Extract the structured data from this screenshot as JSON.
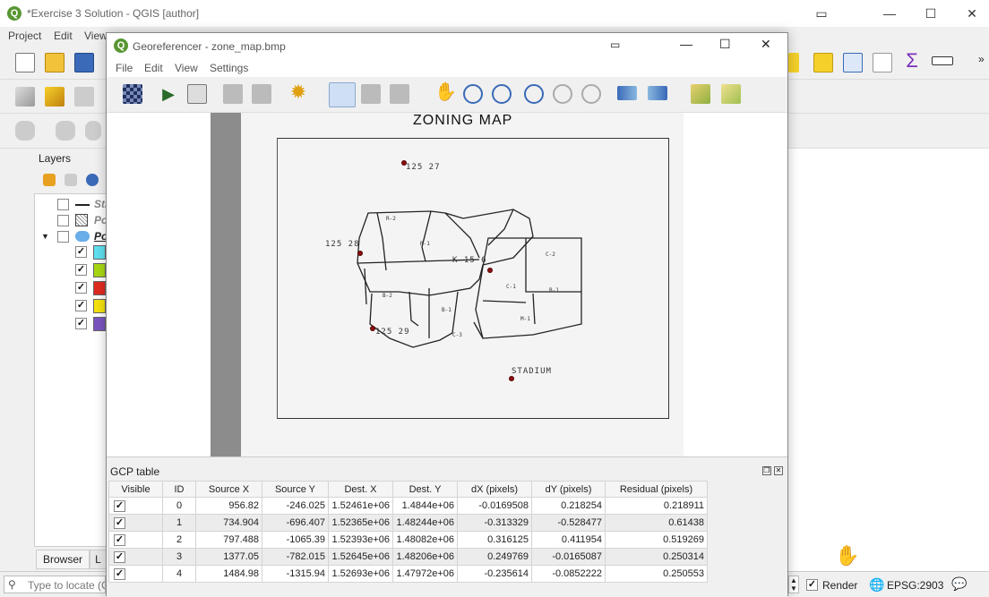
{
  "main_window": {
    "title": "*Exercise 3 Solution - QGIS [author]",
    "logo": "Q",
    "menu": [
      "Project",
      "Edit",
      "View"
    ]
  },
  "layers_panel": {
    "title": "Layers",
    "rows": [
      {
        "label": "Str",
        "checked": false
      },
      {
        "label": "Po",
        "checked": false
      },
      {
        "label": "Po",
        "checked": false
      }
    ],
    "swatches": [
      "#5fe0f0",
      "#a8d812",
      "#e02a20",
      "#f5e210",
      "#7b55c0"
    ],
    "tabs": [
      "Browser",
      "L"
    ]
  },
  "status_bar": {
    "locate_placeholder": "Type to locate (Ct",
    "render_label": "Render",
    "crs_label": "EPSG:2903"
  },
  "georeferencer": {
    "title": "Georeferencer - zone_map.bmp",
    "menu": [
      "File",
      "Edit",
      "View",
      "Settings"
    ],
    "map": {
      "heading": "ZONING MAP",
      "labels": [
        "125 27",
        "125 28",
        "K 15 6",
        "125 29",
        "STADIUM"
      ],
      "zone_labels": [
        "R-2",
        "R-1",
        "C-2",
        "B-2",
        "C-1",
        "B-1",
        "B-1",
        "M-1",
        "C-3"
      ]
    },
    "gcp_table": {
      "title": "GCP table",
      "columns": [
        "Visible",
        "ID",
        "Source X",
        "Source Y",
        "Dest. X",
        "Dest. Y",
        "dX (pixels)",
        "dY (pixels)",
        "Residual (pixels)"
      ],
      "rows": [
        {
          "visible": true,
          "id": "0",
          "source_x": "956.82",
          "source_y": "-246.025",
          "dest_x": "1.52461e+06",
          "dest_y": "1.4844e+06",
          "dx": "-0.0169508",
          "dy": "0.218254",
          "residual": "0.218911"
        },
        {
          "visible": true,
          "id": "1",
          "source_x": "734.904",
          "source_y": "-696.407",
          "dest_x": "1.52365e+06",
          "dest_y": "1.48244e+06",
          "dx": "-0.313329",
          "dy": "-0.528477",
          "residual": "0.61438"
        },
        {
          "visible": true,
          "id": "2",
          "source_x": "797.488",
          "source_y": "-1065.39",
          "dest_x": "1.52393e+06",
          "dest_y": "1.48082e+06",
          "dx": "0.316125",
          "dy": "0.411954",
          "residual": "0.519269"
        },
        {
          "visible": true,
          "id": "3",
          "source_x": "1377.05",
          "source_y": "-782.015",
          "dest_x": "1.52645e+06",
          "dest_y": "1.48206e+06",
          "dx": "0.249769",
          "dy": "-0.0165087",
          "residual": "0.250314"
        },
        {
          "visible": true,
          "id": "4",
          "source_x": "1484.98",
          "source_y": "-1315.94",
          "dest_x": "1.52693e+06",
          "dest_y": "1.47972e+06",
          "dx": "-0.235614",
          "dy": "-0.0852222",
          "residual": "0.250553"
        }
      ]
    }
  },
  "colors": {
    "qgis_green": "#589632",
    "gcp_point": "#8b1010"
  }
}
